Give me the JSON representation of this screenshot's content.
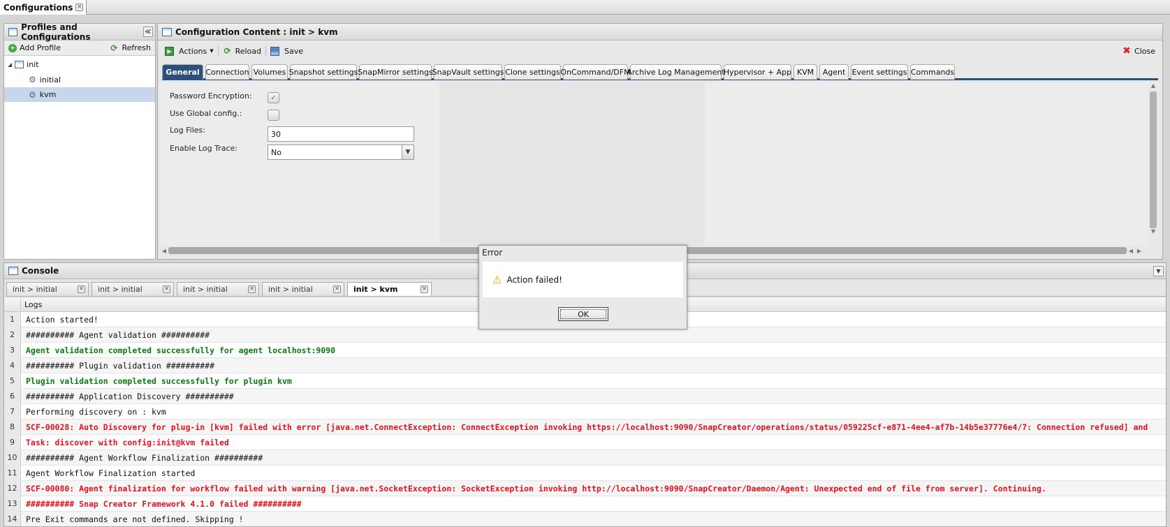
{
  "top_tab": {
    "label": "Configurations"
  },
  "profiles_panel": {
    "title": "Profiles and Configurations",
    "add_profile": "Add Profile",
    "refresh": "Refresh",
    "tree": {
      "root": "init",
      "children": [
        "initial",
        "kvm"
      ],
      "selected": "kvm"
    }
  },
  "content_panel": {
    "title": "Configuration Content : init > kvm",
    "actions": "Actions",
    "reload": "Reload",
    "save": "Save",
    "close": "Close",
    "tabs": [
      "General",
      "Connection",
      "Volumes",
      "Snapshot settings",
      "SnapMirror settings",
      "SnapVault settings",
      "Clone settings",
      "OnCommand/DFM",
      "Archive Log Management",
      "Hypervisor + App",
      "KVM",
      "Agent",
      "Event settings",
      "Commands"
    ],
    "active_tab": "General",
    "form": {
      "password_encryption_label": "Password Encryption:",
      "password_encryption_checked": true,
      "use_global_label": "Use Global config.:",
      "use_global_checked": false,
      "log_files_label": "Log Files:",
      "log_files_value": "30",
      "log_trace_label": "Enable Log Trace:",
      "log_trace_value": "No"
    }
  },
  "console": {
    "title": "Console",
    "tabs": [
      "init > initial",
      "init > initial",
      "init > initial",
      "init > initial",
      "init > kvm"
    ],
    "active_tab_index": 4,
    "logs_header": "Logs",
    "rows": [
      {
        "n": "1",
        "text": "Action started!",
        "style": "normal"
      },
      {
        "n": "2",
        "text": "########## Agent validation ##########",
        "style": "normal"
      },
      {
        "n": "3",
        "text": "Agent validation completed successfully for agent localhost:9090",
        "style": "ok"
      },
      {
        "n": "4",
        "text": "########## Plugin validation ##########",
        "style": "normal"
      },
      {
        "n": "5",
        "text": "Plugin validation completed successfully for plugin kvm",
        "style": "ok"
      },
      {
        "n": "6",
        "text": "########## Application Discovery ##########",
        "style": "normal"
      },
      {
        "n": "7",
        "text": "Performing discovery on : kvm",
        "style": "normal"
      },
      {
        "n": "8",
        "text": "SCF-00028: Auto Discovery for plug-in [kvm] failed with error [java.net.ConnectException: ConnectException invoking https://localhost:9090/SnapCreator/operations/status/059225cf-e871-4ee4-af7b-14b5e37776e4/7: Connection refused] and",
        "style": "error"
      },
      {
        "n": "9",
        "text": "Task: discover with config:init@kvm failed",
        "style": "error"
      },
      {
        "n": "10",
        "text": "########## Agent Workflow Finalization ##########",
        "style": "normal"
      },
      {
        "n": "11",
        "text": "Agent Workflow Finalization started",
        "style": "normal"
      },
      {
        "n": "12",
        "text": "SCF-00080: Agent finalization for workflow failed with warning [java.net.SocketException: SocketException invoking http://localhost:9090/SnapCreator/Daemon/Agent: Unexpected end of file from server]. Continuing.",
        "style": "error"
      },
      {
        "n": "13",
        "text": "########## Snap Creator Framework 4.1.0 failed ##########",
        "style": "error"
      },
      {
        "n": "14",
        "text": "Pre Exit commands are not defined. Skipping !",
        "style": "normal"
      }
    ]
  },
  "dialog": {
    "title": "Error",
    "message": "Action failed!",
    "ok": "OK"
  },
  "colors": {
    "active_tab": "#2d4f7c",
    "selected_row": "#c7d6ea",
    "log_ok": "#0b7a12",
    "log_error": "#e0141e"
  },
  "icons": [
    "close-icon",
    "window-icon",
    "collapse-icon",
    "add-icon",
    "refresh-icon",
    "list-icon",
    "config-icon",
    "actions-icon",
    "save-icon",
    "warning-icon",
    "dropdown-arrow-icon"
  ]
}
